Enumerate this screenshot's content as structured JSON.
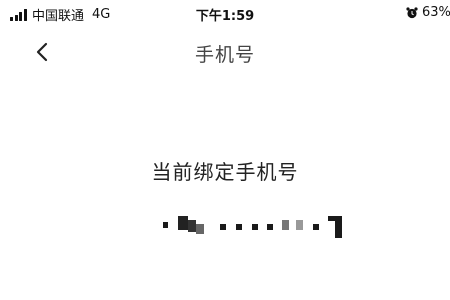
{
  "status_bar": {
    "carrier": "中国联通",
    "network": "4G",
    "time": "下午1:59",
    "battery": "63%",
    "icons": [
      "signal-icon",
      "alarm-icon"
    ]
  },
  "nav": {
    "title": "手机号",
    "back_icon": "chevron-left-icon"
  },
  "content": {
    "current_label": "当前绑定手机号",
    "phone_masked": true
  }
}
